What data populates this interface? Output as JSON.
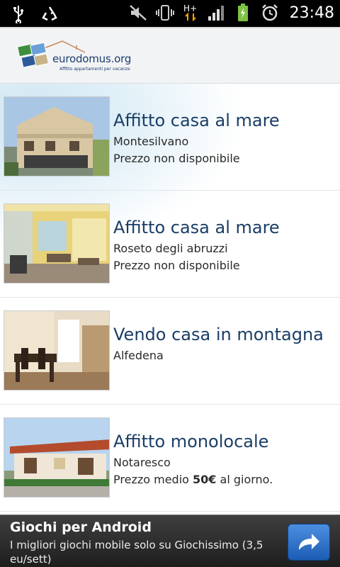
{
  "status_bar": {
    "time": "23:48",
    "network_label": "H+",
    "icons": [
      "usb-icon",
      "recycle-icon",
      "mute-icon",
      "vibrate-icon",
      "network-hplus-icon",
      "signal-icon",
      "battery-charging-icon",
      "alarm-icon"
    ]
  },
  "header": {
    "logo_text": "eurodomus.org",
    "logo_tagline": "Affitto appartamenti per vacanze"
  },
  "listings": [
    {
      "title": "Affitto casa al mare",
      "line1": "Montesilvano",
      "line2": "Prezzo non disponibile",
      "thumb": "house-facade"
    },
    {
      "title": "Affitto casa al mare",
      "line1": "Roseto degli abruzzi",
      "line2": "Prezzo non disponibile",
      "thumb": "yellow-patio"
    },
    {
      "title": "Vendo casa in montagna",
      "line1": "Alfedena",
      "line2": "",
      "thumb": "dining-room"
    },
    {
      "title": "Affitto monolocale",
      "line1": "Notaresco",
      "line2_prefix": "Prezzo medio ",
      "line2_bold": "50€",
      "line2_suffix": " al giorno.",
      "thumb": "bungalow"
    }
  ],
  "ad": {
    "title": "Giochi per Android",
    "text": "I migliori giochi mobile solo su Giochissimo (3,5 eu/sett)",
    "button_icon": "share-arrow-icon"
  },
  "colors": {
    "title_blue": "#1b3e66",
    "logo_blue": "#1a3b70",
    "ad_button": "#2e72c9"
  }
}
